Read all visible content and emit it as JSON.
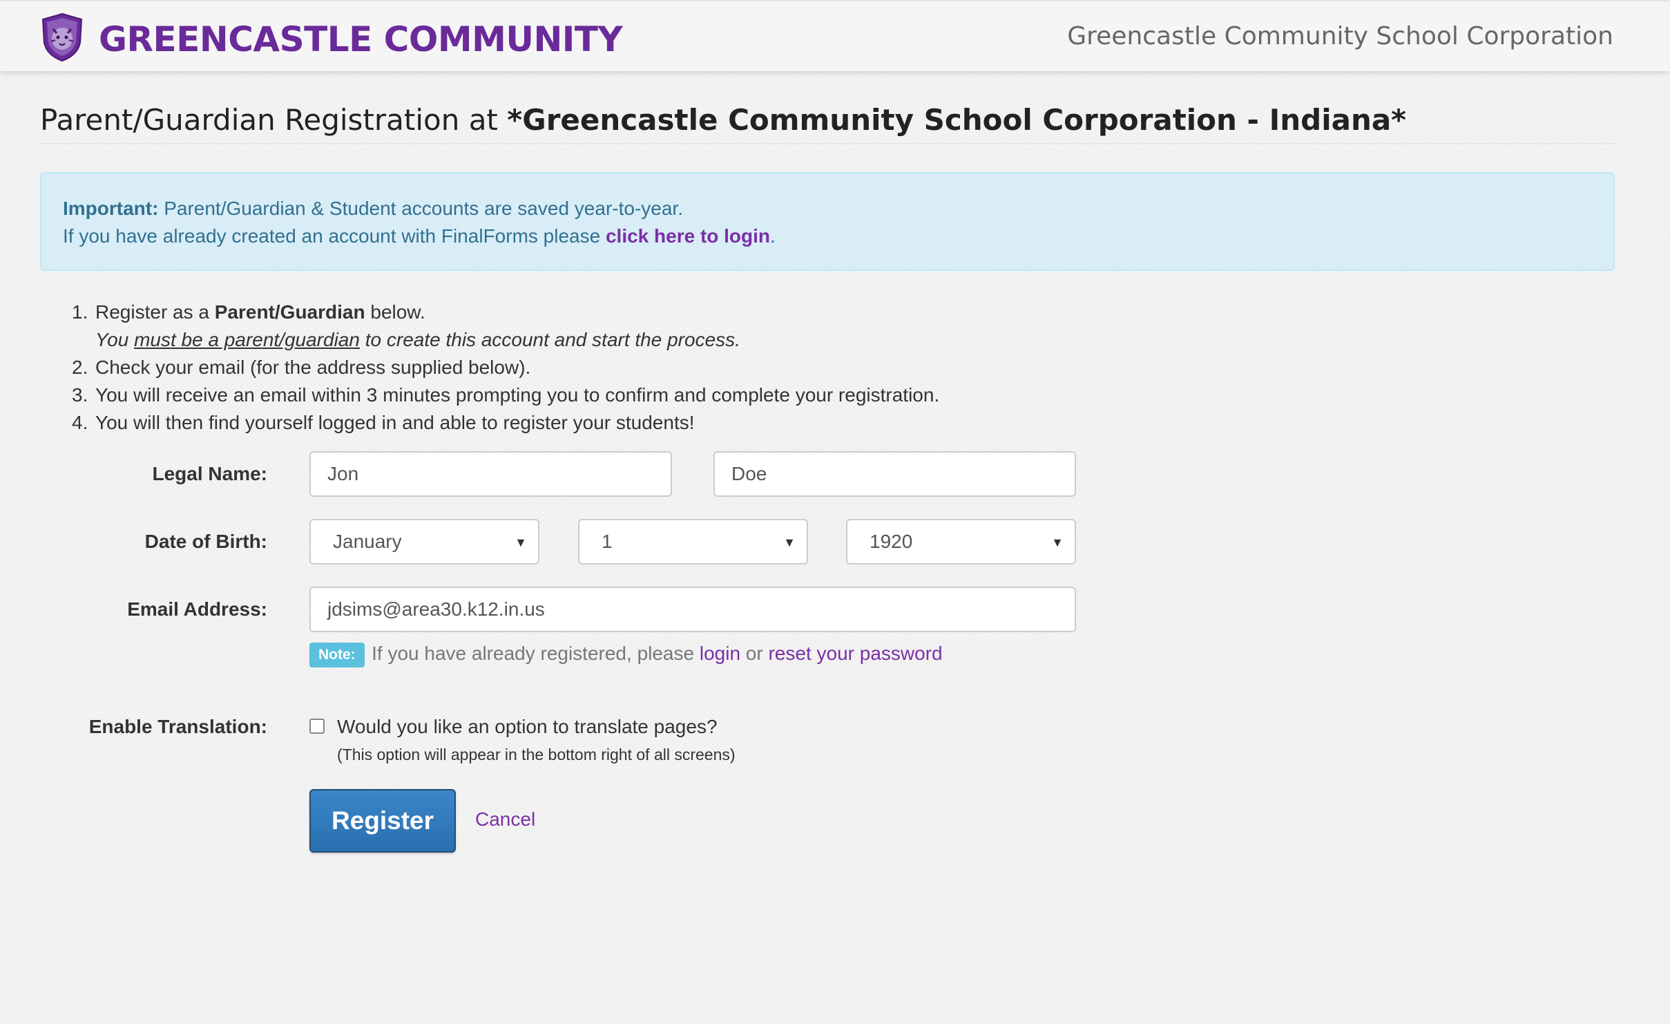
{
  "header": {
    "brand": "GREENCASTLE COMMUNITY",
    "right_text": "Greencastle Community School Corporation",
    "logo_icon": "tiger-shield-logo",
    "brand_color": "#6a2a9a"
  },
  "page": {
    "title_prefix": "Parent/Guardian Registration at ",
    "title_org": "*Greencastle Community School Corporation - Indiana*"
  },
  "alert": {
    "strong": "Important:",
    "line1": " Parent/Guardian & Student accounts are saved year-to-year.",
    "line2": "If you have already created an account with FinalForms please ",
    "login_link": "click here to login",
    "line2_end": "."
  },
  "steps": {
    "s1_num": "1.",
    "s1_pre": "Register as a ",
    "s1_bold": "Parent/Guardian",
    "s1_post": " below.",
    "s1_sub_pre": "You ",
    "s1_sub_u": "must be a parent/guardian",
    "s1_sub_post": " to create this account and start the process.",
    "s2_num": "2.",
    "s2": "Check your email (for the address supplied below).",
    "s3_num": "3.",
    "s3": "You will receive an email within 3 minutes prompting you to confirm and complete your registration.",
    "s4_num": "4.",
    "s4": "You will then find yourself logged in and able to register your students!"
  },
  "form": {
    "legal_name_label": "Legal Name:",
    "first_name": "Jon",
    "last_name": "Doe",
    "dob_label": "Date of Birth:",
    "dob_month": "January",
    "dob_day": "1",
    "dob_year": "1920",
    "email_label": "Email Address:",
    "email": "jdsims@area30.k12.in.us",
    "note_badge": "Note:",
    "note_text": "If you have already registered, please ",
    "note_login": "login",
    "note_or": " or ",
    "note_reset": "reset your password",
    "translation_label": "Enable Translation:",
    "translation_question": "Would you like an option to translate pages?",
    "translation_help": "(This option will appear in the bottom right of all screens)",
    "translation_checked": false,
    "register_button": "Register",
    "cancel_link": "Cancel"
  },
  "colors": {
    "link": "#7b2fa6",
    "alert_bg": "#d9edf7",
    "alert_text": "#31708f",
    "primary_button": "#2a6fb0",
    "note_badge": "#5bc0de"
  }
}
